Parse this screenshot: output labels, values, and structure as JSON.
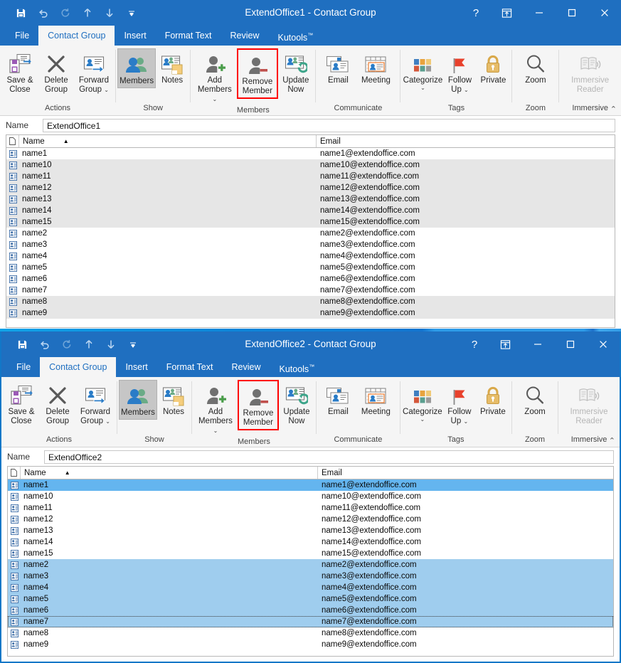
{
  "common": {
    "tabs": [
      "File",
      "Contact Group",
      "Insert",
      "Format Text",
      "Review",
      "Kutools"
    ],
    "kutools_sup": "™",
    "active_tab": "Contact Group",
    "qat": [
      "save-icon",
      "undo-icon",
      "redo-icon",
      "up-arrow-icon",
      "down-arrow-icon",
      "customize-qat-icon"
    ],
    "window_controls": [
      "help-icon",
      "ribbon-display-options-icon",
      "minimize-icon",
      "maximize-icon",
      "close-icon"
    ],
    "ribbon": {
      "groups": [
        {
          "label": "Actions",
          "buttons": [
            {
              "label": "Save &\nClose",
              "icon": "save-and-close-icon",
              "state": "normal"
            },
            {
              "label": "Delete\nGroup",
              "icon": "delete-group-icon",
              "state": "normal"
            },
            {
              "label": "Forward\nGroup",
              "icon": "forward-group-icon",
              "state": "normal",
              "caret": true
            }
          ]
        },
        {
          "label": "Show",
          "buttons": [
            {
              "label": "Members",
              "icon": "members-icon",
              "state": "selected"
            },
            {
              "label": "Notes",
              "icon": "notes-icon",
              "state": "normal"
            }
          ]
        },
        {
          "label": "Members",
          "buttons": [
            {
              "label": "Add\nMembers",
              "icon": "add-member-icon",
              "state": "normal",
              "caret": true
            },
            {
              "label": "Remove\nMember",
              "icon": "remove-member-icon",
              "state": "highlighted"
            },
            {
              "label": "Update\nNow",
              "icon": "update-now-icon",
              "state": "normal"
            }
          ]
        },
        {
          "label": "Communicate",
          "buttons": [
            {
              "label": "Email",
              "icon": "email-icon",
              "state": "normal"
            },
            {
              "label": "Meeting",
              "icon": "meeting-icon",
              "state": "normal"
            }
          ]
        },
        {
          "label": "Tags",
          "buttons": [
            {
              "label": "Categorize",
              "icon": "categorize-icon",
              "state": "normal",
              "caret": true
            },
            {
              "label": "Follow\nUp",
              "icon": "follow-up-flag-icon",
              "state": "normal",
              "caret": true
            },
            {
              "label": "Private",
              "icon": "private-lock-icon",
              "state": "normal"
            }
          ]
        },
        {
          "label": "Zoom",
          "buttons": [
            {
              "label": "Zoom",
              "icon": "zoom-magnifier-icon",
              "state": "normal"
            }
          ]
        },
        {
          "label": "Immersive",
          "buttons": [
            {
              "label": "Immersive\nReader",
              "icon": "immersive-reader-icon",
              "state": "disabled"
            }
          ]
        }
      ],
      "collapse_icon": "chevron-up-icon"
    },
    "name_label": "Name",
    "columns": {
      "icon": "",
      "name": "Name",
      "email": "Email"
    },
    "colors": {
      "titlebar": "#1f6fc0",
      "ribbon_bg": "#f5f5f5",
      "highlight_border": "#ff0000",
      "row_shade": "#e6e6e6",
      "row_selected": "#9fcdee",
      "row_selected_active": "#64b5ef",
      "desktop": "#0a7fd4"
    }
  },
  "window1": {
    "title": "ExtendOffice1  -  Contact Group",
    "group_name": "ExtendOffice1",
    "rows": [
      {
        "name": "name1",
        "email": "name1@extendoffice.com",
        "state": "normal"
      },
      {
        "name": "name10",
        "email": "name10@extendoffice.com",
        "state": "shaded"
      },
      {
        "name": "name11",
        "email": "name11@extendoffice.com",
        "state": "shaded"
      },
      {
        "name": "name12",
        "email": "name12@extendoffice.com",
        "state": "shaded"
      },
      {
        "name": "name13",
        "email": "name13@extendoffice.com",
        "state": "shaded"
      },
      {
        "name": "name14",
        "email": "name14@extendoffice.com",
        "state": "shaded"
      },
      {
        "name": "name15",
        "email": "name15@extendoffice.com",
        "state": "shaded"
      },
      {
        "name": "name2",
        "email": "name2@extendoffice.com",
        "state": "normal"
      },
      {
        "name": "name3",
        "email": "name3@extendoffice.com",
        "state": "normal"
      },
      {
        "name": "name4",
        "email": "name4@extendoffice.com",
        "state": "normal"
      },
      {
        "name": "name5",
        "email": "name5@extendoffice.com",
        "state": "normal"
      },
      {
        "name": "name6",
        "email": "name6@extendoffice.com",
        "state": "normal"
      },
      {
        "name": "name7",
        "email": "name7@extendoffice.com",
        "state": "normal"
      },
      {
        "name": "name8",
        "email": "name8@extendoffice.com",
        "state": "shaded"
      },
      {
        "name": "name9",
        "email": "name9@extendoffice.com",
        "state": "shaded"
      }
    ]
  },
  "window2": {
    "title": "ExtendOffice2  -  Contact Group",
    "group_name": "ExtendOffice2",
    "rows": [
      {
        "name": "name1",
        "email": "name1@extendoffice.com",
        "state": "selected-active"
      },
      {
        "name": "name10",
        "email": "name10@extendoffice.com",
        "state": "normal"
      },
      {
        "name": "name11",
        "email": "name11@extendoffice.com",
        "state": "normal"
      },
      {
        "name": "name12",
        "email": "name12@extendoffice.com",
        "state": "normal"
      },
      {
        "name": "name13",
        "email": "name13@extendoffice.com",
        "state": "normal"
      },
      {
        "name": "name14",
        "email": "name14@extendoffice.com",
        "state": "normal"
      },
      {
        "name": "name15",
        "email": "name15@extendoffice.com",
        "state": "normal"
      },
      {
        "name": "name2",
        "email": "name2@extendoffice.com",
        "state": "selected"
      },
      {
        "name": "name3",
        "email": "name3@extendoffice.com",
        "state": "selected"
      },
      {
        "name": "name4",
        "email": "name4@extendoffice.com",
        "state": "selected"
      },
      {
        "name": "name5",
        "email": "name5@extendoffice.com",
        "state": "selected"
      },
      {
        "name": "name6",
        "email": "name6@extendoffice.com",
        "state": "selected"
      },
      {
        "name": "name7",
        "email": "name7@extendoffice.com",
        "state": "selected-focus"
      },
      {
        "name": "name8",
        "email": "name8@extendoffice.com",
        "state": "normal"
      },
      {
        "name": "name9",
        "email": "name9@extendoffice.com",
        "state": "normal"
      }
    ]
  }
}
